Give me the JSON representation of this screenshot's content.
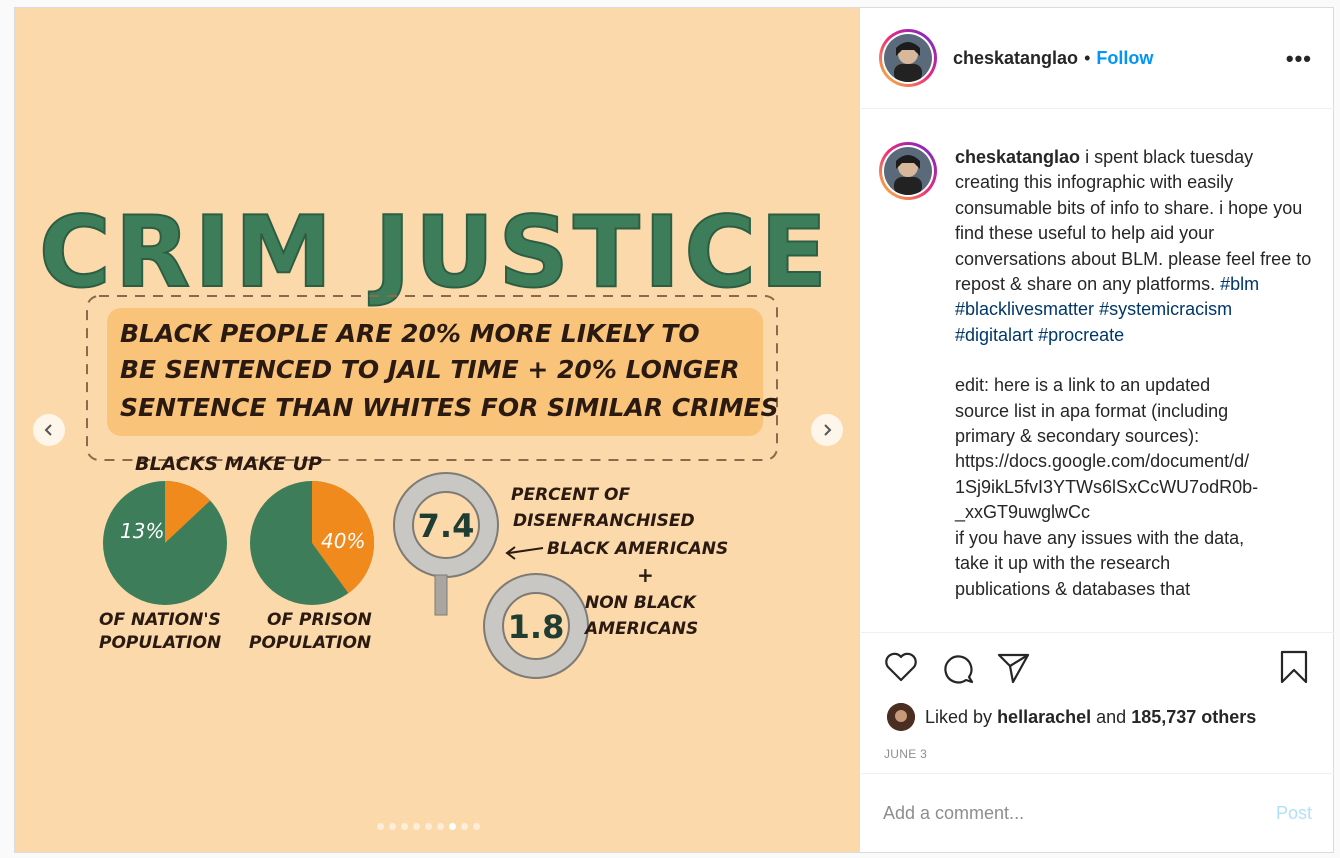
{
  "media": {
    "title": "CRIM JUSTICE",
    "banner_lines": [
      "BLACK PEOPLE ARE 20% MORE LIKELY TO",
      "BE SENTENCED TO JAIL TIME + 20% LONGER",
      "SENTENCE THAN WHITES FOR SIMILAR CRIMES"
    ],
    "blacks_make_up": "BLACKS MAKE UP",
    "pie1_label": "13%",
    "pie1_value": 13,
    "pie1_caption": [
      "OF NATION'S",
      "POPULATION"
    ],
    "pie2_label": "40%",
    "pie2_value": 40,
    "pie2_caption": [
      "OF PRISON",
      "POPULATION"
    ],
    "cuff1_value": "7.4",
    "cuff2_value": "1.8",
    "cuff_text1": [
      "PERCENT OF",
      "DISENFRANCHISED",
      "BLACK AMERICANS"
    ],
    "plus": "+",
    "cuff_text2": [
      "NON BLACK",
      "AMERICANS"
    ],
    "slide_count": 9,
    "active_slide": 6
  },
  "colors": {
    "bg": "#fbd9aa",
    "green": "#3d7d5a",
    "orange": "#f08a1c",
    "dark": "#2a1a12",
    "banner": "#f9c37a"
  },
  "header": {
    "username": "cheskatanglao",
    "separator": "•",
    "follow_label": "Follow",
    "more_label": "•••"
  },
  "caption": {
    "username": "cheskatanglao",
    "text": "i spent black tuesday creating this infographic with easily consumable bits of info to share. i hope you find these useful to help aid your conversations about BLM. please feel free to repost & share on any platforms.",
    "tags": [
      "#blm",
      "#blacklivesmatter",
      "#systemicracism",
      "#digitalart",
      "#procreate"
    ],
    "edit_lines": [
      "edit: here is a link to an updated",
      "source list in apa format (including",
      "primary & secondary sources):",
      "https://docs.google.com/document/d/",
      "1Sj9ikL5fvI3YTWs6lSxCcWU7odR0b-",
      "_xxGT9uwglwCc",
      "if you have any issues with the data,",
      "take it up with the research",
      "publications & databases that"
    ]
  },
  "likes": {
    "prefix": "Liked by",
    "user": "hellarachel",
    "middle": "and",
    "count": "185,737 others"
  },
  "date": "JUNE 3",
  "comment": {
    "placeholder": "Add a comment...",
    "post_label": "Post"
  },
  "icons": [
    "heart-icon",
    "comment-icon",
    "share-icon",
    "bookmark-icon",
    "chevron-left-icon",
    "chevron-right-icon"
  ]
}
